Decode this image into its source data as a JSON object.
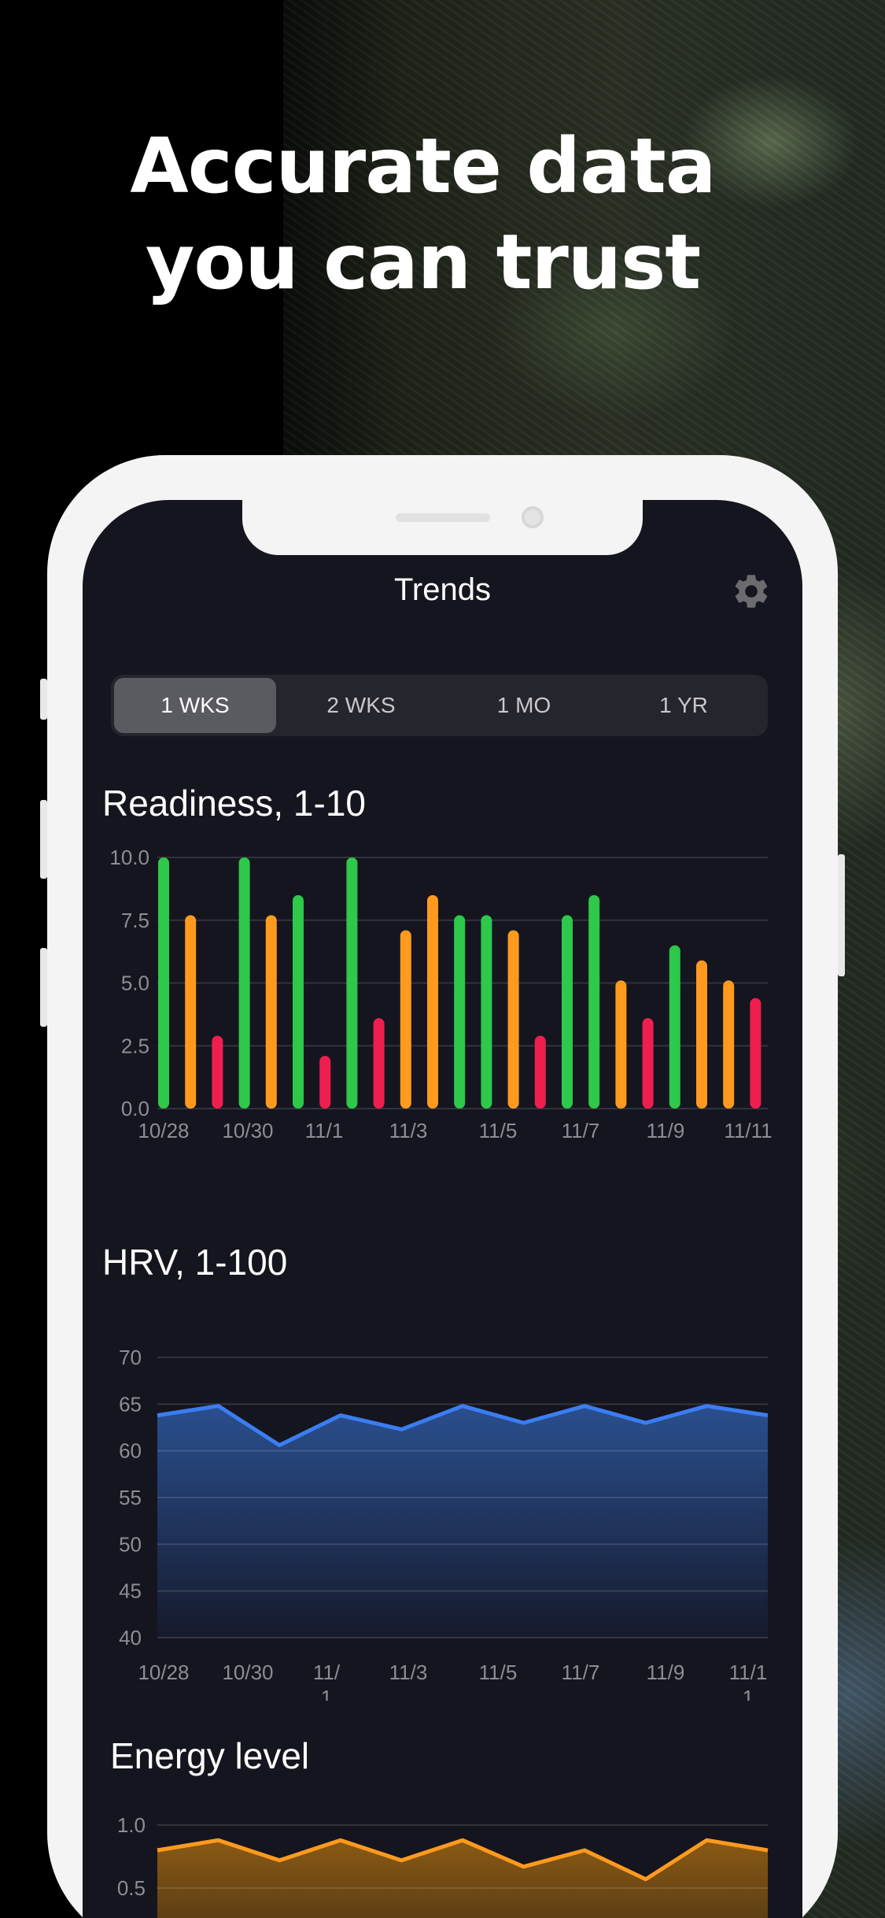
{
  "headline": {
    "line1": "Accurate data",
    "line2": "you can trust"
  },
  "nav": {
    "title": "Trends",
    "settings_icon": "gear-icon"
  },
  "range_tabs": [
    {
      "label": "1 WKS",
      "selected": true
    },
    {
      "label": "2 WKS",
      "selected": false
    },
    {
      "label": "1 MO",
      "selected": false
    },
    {
      "label": "1 YR",
      "selected": false
    }
  ],
  "sections": {
    "readiness_title": "Readiness, 1-10",
    "hrv_title": "HRV, 1-100",
    "energy_title": "Energy level"
  },
  "colors": {
    "background": "#15151f",
    "green": "#2ec84a",
    "orange": "#ff9a1f",
    "red": "#ee1f4f",
    "hrv_line": "#3b7df2",
    "energy_line": "#ff9a1f"
  },
  "chart_data": [
    {
      "type": "bar",
      "title": "Readiness, 1-10",
      "ylim": [
        0,
        10
      ],
      "yticks": [
        "10.0",
        "7.5",
        "5.0",
        "2.5",
        "0.0"
      ],
      "xticks": [
        "10/28",
        "10/30",
        "11/1",
        "11/3",
        "11/5",
        "11/7",
        "11/9",
        "11/11"
      ],
      "values": [
        10.0,
        7.7,
        2.9,
        10.0,
        7.7,
        8.5,
        2.1,
        10.0,
        3.6,
        7.1,
        8.5,
        7.7,
        7.7,
        7.1,
        2.9,
        7.7,
        8.5,
        5.1,
        3.6,
        6.5,
        5.9,
        5.1,
        4.4
      ],
      "colors": [
        "green",
        "orange",
        "red",
        "green",
        "orange",
        "green",
        "red",
        "green",
        "red",
        "orange",
        "orange",
        "green",
        "green",
        "orange",
        "red",
        "green",
        "green",
        "orange",
        "red",
        "green",
        "orange",
        "orange",
        "red"
      ]
    },
    {
      "type": "area",
      "title": "HRV, 1-100",
      "ylim": [
        40,
        70
      ],
      "yticks": [
        "70",
        "65",
        "60",
        "55",
        "50",
        "45",
        "40"
      ],
      "xticks": [
        "10/28",
        "10/30",
        "11/\n1",
        "11/3",
        "11/5",
        "11/7",
        "11/9",
        "11/1\n1"
      ],
      "values": [
        63.8,
        64.8,
        60.6,
        63.8,
        62.3,
        64.8,
        63.0,
        64.8,
        63.0,
        64.8,
        63.8
      ]
    },
    {
      "type": "area",
      "title": "Energy level",
      "ylim": [
        0,
        1
      ],
      "yticks": [
        "1.0",
        "0.5"
      ],
      "values": [
        0.8,
        0.88,
        0.72,
        0.88,
        0.72,
        0.88,
        0.67,
        0.8,
        0.57,
        0.88,
        0.8
      ]
    }
  ]
}
